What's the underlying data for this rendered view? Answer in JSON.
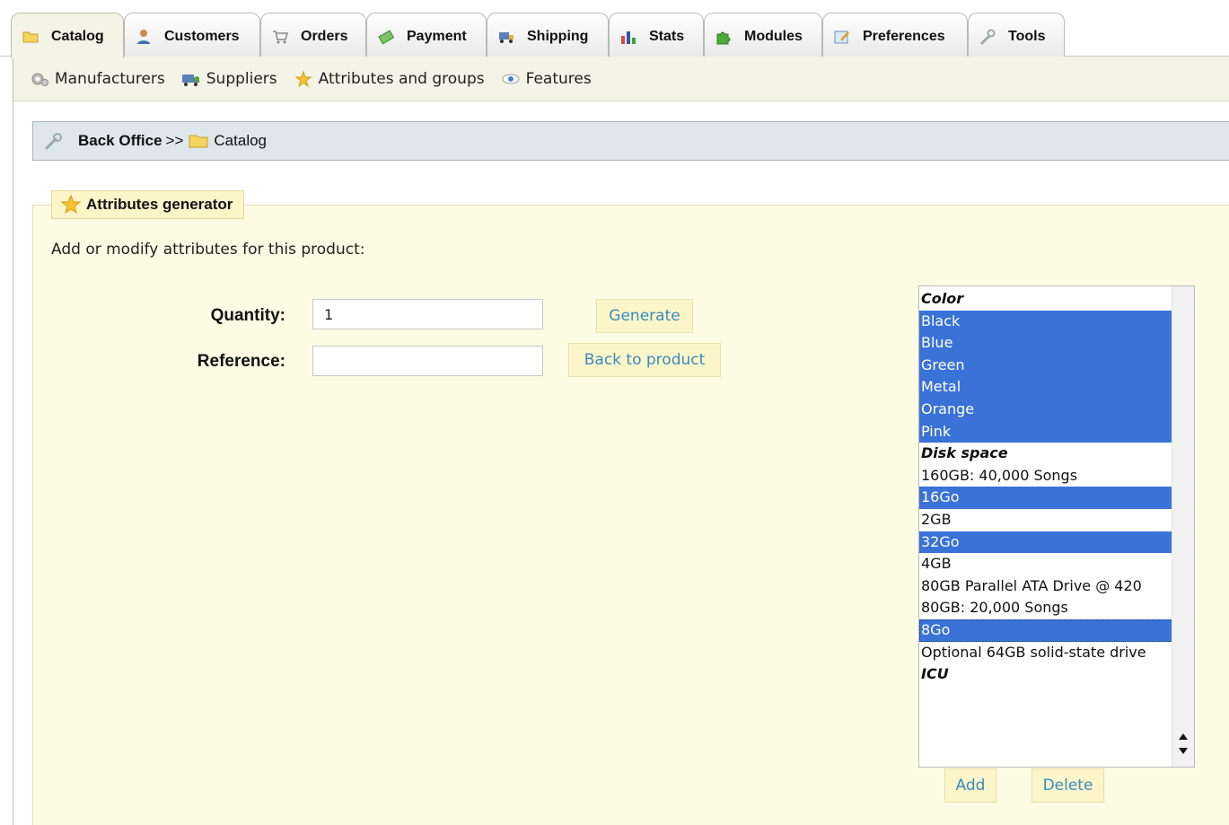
{
  "tabs": [
    {
      "label": "Catalog",
      "icon": "folder-icon",
      "active": true
    },
    {
      "label": "Customers",
      "icon": "customer-icon",
      "active": false
    },
    {
      "label": "Orders",
      "icon": "cart-icon",
      "active": false
    },
    {
      "label": "Payment",
      "icon": "money-icon",
      "active": false
    },
    {
      "label": "Shipping",
      "icon": "truck-icon",
      "active": false
    },
    {
      "label": "Stats",
      "icon": "stats-icon",
      "active": false
    },
    {
      "label": "Modules",
      "icon": "puzzle-icon",
      "active": false
    },
    {
      "label": "Preferences",
      "icon": "preferences-icon",
      "active": false
    },
    {
      "label": "Tools",
      "icon": "wrench-icon",
      "active": false
    }
  ],
  "subnav": [
    {
      "label": "Manufacturers",
      "icon": "gear-icon"
    },
    {
      "label": "Suppliers",
      "icon": "supplier-truck-icon"
    },
    {
      "label": "Attributes and groups",
      "icon": "attribute-star-icon"
    },
    {
      "label": "Features",
      "icon": "eye-icon"
    }
  ],
  "breadcrumb": {
    "root": "Back Office",
    "separator": ">>",
    "current": "Catalog"
  },
  "generator": {
    "legend": "Attributes generator",
    "intro": "Add or modify attributes for this product:",
    "quantity_label": "Quantity:",
    "quantity_value": "1",
    "reference_label": "Reference:",
    "reference_value": "",
    "generate_button": "Generate",
    "back_button": "Back to product",
    "add_button": "Add",
    "delete_button": "Delete"
  },
  "attribute_list": [
    {
      "type": "group",
      "label": "Color"
    },
    {
      "type": "option",
      "label": "Black",
      "selected": true
    },
    {
      "type": "option",
      "label": "Blue",
      "selected": true
    },
    {
      "type": "option",
      "label": "Green",
      "selected": true
    },
    {
      "type": "option",
      "label": "Metal",
      "selected": true
    },
    {
      "type": "option",
      "label": "Orange",
      "selected": true
    },
    {
      "type": "option",
      "label": "Pink",
      "selected": true
    },
    {
      "type": "group",
      "label": "Disk space"
    },
    {
      "type": "option",
      "label": "160GB: 40,000 Songs",
      "selected": false
    },
    {
      "type": "option",
      "label": "16Go",
      "selected": true
    },
    {
      "type": "option",
      "label": "2GB",
      "selected": false
    },
    {
      "type": "option",
      "label": "32Go",
      "selected": true
    },
    {
      "type": "option",
      "label": "4GB",
      "selected": false
    },
    {
      "type": "option",
      "label": "80GB Parallel ATA Drive @ 420",
      "selected": false
    },
    {
      "type": "option",
      "label": "80GB: 20,000 Songs",
      "selected": false
    },
    {
      "type": "option",
      "label": "8Go",
      "selected": true,
      "focused": true
    },
    {
      "type": "option",
      "label": "Optional 64GB solid-state drive",
      "selected": false
    },
    {
      "type": "group",
      "label": "ICU"
    }
  ],
  "colors": {
    "selection": "#3a72d8",
    "link": "#3a8bc0",
    "panel": "#fcfbe3",
    "button": "#fcf5c9"
  }
}
